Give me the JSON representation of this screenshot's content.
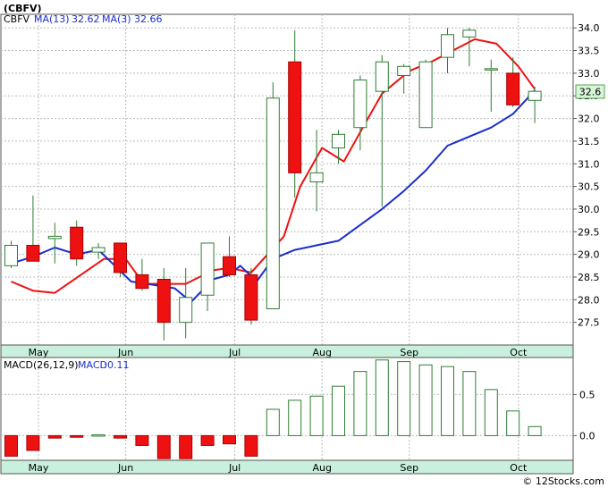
{
  "chart_data": [
    {
      "type": "candlestick",
      "title": "(CBFV)",
      "legend": [
        {
          "label": "MA(13)",
          "value": "32.62"
        },
        {
          "label": "MA(3)",
          "value": "32.66"
        }
      ],
      "last_price_label": "32.6",
      "ylim": [
        27.0,
        34.3
      ],
      "y_ticks": [
        "27.5",
        "28.0",
        "28.5",
        "29.0",
        "29.5",
        "30.0",
        "30.5",
        "31.0",
        "31.5",
        "32.0",
        "32.5",
        "33.0",
        "33.5",
        "34.0"
      ],
      "x_month_labels": [
        {
          "label": "May",
          "at": 1.25
        },
        {
          "label": "Jun",
          "at": 5.25
        },
        {
          "label": "Jul",
          "at": 10.25
        },
        {
          "label": "Aug",
          "at": 14.25
        },
        {
          "label": "Sep",
          "at": 18.25
        },
        {
          "label": "Oct",
          "at": 23.25
        }
      ],
      "candles": [
        {
          "o": 28.75,
          "h": 29.3,
          "l": 28.7,
          "c": 29.2
        },
        {
          "o": 29.2,
          "h": 30.3,
          "l": 28.85,
          "c": 28.85
        },
        {
          "o": 29.35,
          "h": 29.7,
          "l": 28.8,
          "c": 29.4
        },
        {
          "o": 29.6,
          "h": 29.75,
          "l": 28.75,
          "c": 28.9
        },
        {
          "o": 29.05,
          "h": 29.25,
          "l": 28.9,
          "c": 29.15
        },
        {
          "o": 29.25,
          "h": 29.25,
          "l": 28.5,
          "c": 28.6
        },
        {
          "o": 28.55,
          "h": 28.9,
          "l": 28.2,
          "c": 28.25
        },
        {
          "o": 28.45,
          "h": 28.7,
          "l": 27.1,
          "c": 27.5
        },
        {
          "o": 27.5,
          "h": 28.7,
          "l": 27.15,
          "c": 28.05
        },
        {
          "o": 28.1,
          "h": 29.25,
          "l": 27.75,
          "c": 29.25
        },
        {
          "o": 28.95,
          "h": 29.4,
          "l": 28.5,
          "c": 28.55
        },
        {
          "o": 28.55,
          "h": 28.7,
          "l": 27.45,
          "c": 27.55
        },
        {
          "o": 27.8,
          "h": 32.8,
          "l": 27.8,
          "c": 32.45
        },
        {
          "o": 33.25,
          "h": 33.95,
          "l": 30.25,
          "c": 30.8
        },
        {
          "o": 30.6,
          "h": 31.75,
          "l": 29.95,
          "c": 30.8
        },
        {
          "o": 31.35,
          "h": 31.75,
          "l": 31.0,
          "c": 31.65
        },
        {
          "o": 31.8,
          "h": 32.95,
          "l": 31.3,
          "c": 32.85
        },
        {
          "o": 32.6,
          "h": 33.4,
          "l": 30.05,
          "c": 33.25
        },
        {
          "o": 32.95,
          "h": 33.2,
          "l": 32.55,
          "c": 33.15
        },
        {
          "o": 31.8,
          "h": 33.3,
          "l": 31.8,
          "c": 33.25
        },
        {
          "o": 33.35,
          "h": 34.0,
          "l": 33.0,
          "c": 33.85
        },
        {
          "o": 33.8,
          "h": 34.0,
          "l": 33.15,
          "c": 33.95
        },
        {
          "o": 33.1,
          "h": 33.3,
          "l": 32.15,
          "c": 33.1
        },
        {
          "o": 33.0,
          "h": 33.35,
          "l": 32.25,
          "c": 32.3
        },
        {
          "o": 32.4,
          "h": 32.7,
          "l": 31.9,
          "c": 32.6
        }
      ],
      "series": [
        {
          "name": "MA(3)",
          "color": "#ee1111",
          "points": [
            [
              0,
              28.4
            ],
            [
              1,
              28.2
            ],
            [
              2,
              28.15
            ],
            [
              4.25,
              28.9
            ],
            [
              5.25,
              28.9
            ],
            [
              6,
              28.4
            ],
            [
              6.25,
              28.35
            ],
            [
              7,
              28.35
            ],
            [
              8,
              28.35
            ],
            [
              9.25,
              28.65
            ],
            [
              10,
              28.7
            ],
            [
              11,
              28.6
            ],
            [
              12.5,
              29.4
            ],
            [
              13.25,
              30.5
            ],
            [
              14.25,
              31.35
            ],
            [
              15.25,
              31.05
            ],
            [
              16,
              31.7
            ],
            [
              17,
              32.55
            ],
            [
              18.25,
              33.05
            ],
            [
              19.25,
              33.25
            ],
            [
              20.25,
              33.5
            ],
            [
              21.25,
              33.75
            ],
            [
              22.25,
              33.65
            ],
            [
              23.25,
              33.15
            ],
            [
              24,
              32.65
            ]
          ]
        },
        {
          "name": "MA(13)",
          "color": "#1a2ecc",
          "points": [
            [
              0,
              28.8
            ],
            [
              1,
              28.95
            ],
            [
              2,
              29.15
            ],
            [
              3,
              29.0
            ],
            [
              4,
              29.1
            ],
            [
              5.5,
              28.4
            ],
            [
              6.25,
              28.35
            ],
            [
              7.5,
              28.25
            ],
            [
              8.25,
              27.95
            ],
            [
              9.25,
              28.45
            ],
            [
              10,
              28.55
            ],
            [
              10.5,
              28.75
            ],
            [
              11.25,
              28.4
            ],
            [
              12,
              28.9
            ],
            [
              13,
              29.1
            ],
            [
              14,
              29.2
            ],
            [
              15,
              29.3
            ],
            [
              16,
              29.65
            ],
            [
              17,
              30.0
            ],
            [
              18,
              30.4
            ],
            [
              19,
              30.85
            ],
            [
              20,
              31.4
            ],
            [
              21,
              31.6
            ],
            [
              22,
              31.8
            ],
            [
              23,
              32.1
            ],
            [
              24,
              32.62
            ]
          ]
        }
      ]
    },
    {
      "type": "bar",
      "title": "MACD(26,12,9)",
      "legend_label": "MACD",
      "legend_value": "0.11",
      "ylim": [
        -0.3,
        0.95
      ],
      "y_ticks": [
        "0.5",
        "0.0"
      ],
      "values": [
        -0.25,
        -0.18,
        -0.03,
        -0.02,
        0.01,
        -0.03,
        -0.12,
        -0.28,
        -0.28,
        -0.12,
        -0.1,
        -0.25,
        0.32,
        0.43,
        0.48,
        0.6,
        0.78,
        0.92,
        0.9,
        0.86,
        0.84,
        0.78,
        0.56,
        0.3,
        0.11
      ]
    }
  ],
  "watermark": "© 12Stocks.com"
}
